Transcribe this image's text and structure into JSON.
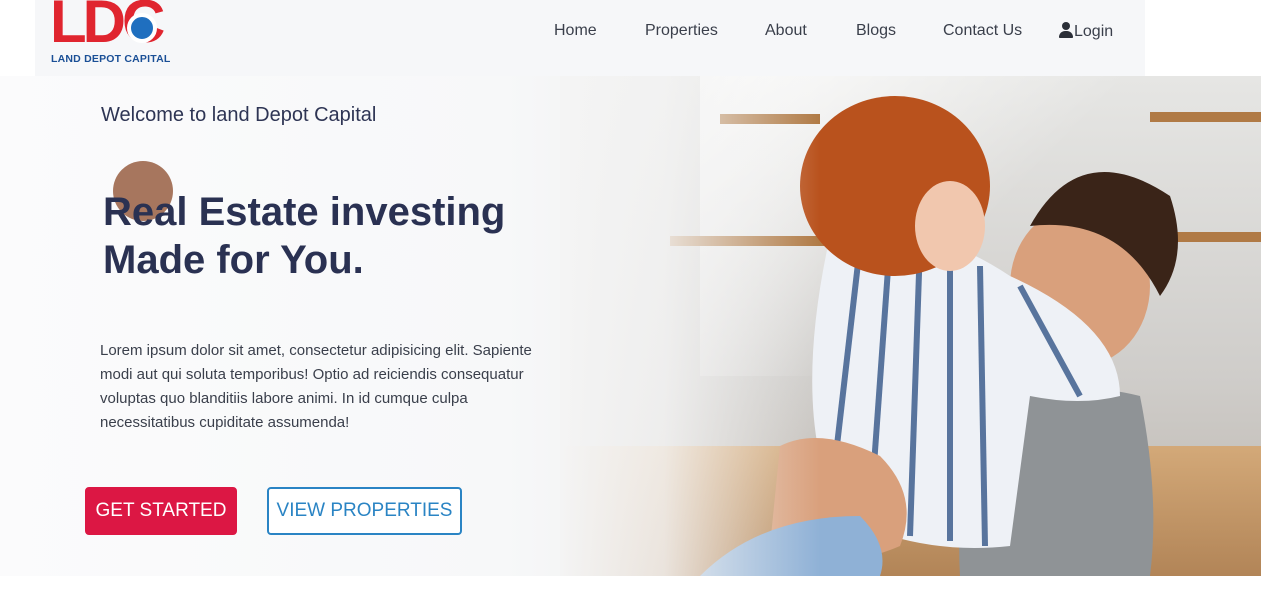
{
  "logo": {
    "letters": "LDC",
    "subtitle": "LAND DEPOT CAPITAL",
    "primary_color": "#e0252f",
    "secondary_color": "#1a4f96"
  },
  "nav": {
    "items": [
      "Home",
      "Properties",
      "About",
      "Blogs",
      "Contact Us"
    ],
    "login_label": "Login"
  },
  "hero": {
    "welcome": "Welcome to land Depot Capital",
    "headline_line1": "Real Estate investing",
    "headline_line2": "Made for You.",
    "paragraph": "Lorem ipsum dolor sit amet, consectetur adipisicing elit. Sapiente modi aut qui soluta temporibus! Optio ad reiciendis consequatur voluptas quo blanditiis labore animi. In id cumque culpa necessitatibus cupiditate assumenda!",
    "primary_button": "GET STARTED",
    "secondary_button": "VIEW PROPERTIES",
    "colors": {
      "headline": "#2a3152",
      "primary_button": "#dc1744",
      "secondary_button": "#2a84c4"
    }
  }
}
